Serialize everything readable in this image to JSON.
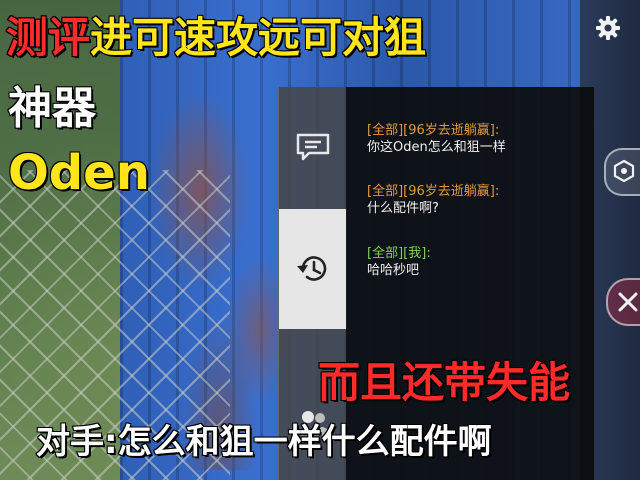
{
  "captions": {
    "title_red": "测评",
    "title_yellow": "进可速攻远可对狙",
    "subtitle_line1": "神器",
    "subtitle_line2": "Oden",
    "highlight": "而且还带失能",
    "bottom": "对手:怎么和狙一样什么配件啊"
  },
  "chat": {
    "messages": [
      {
        "channel": "[全部]",
        "sender": "[96岁去逝躺赢]",
        "suffix": ":",
        "text": "你这Oden怎么和狙一样",
        "head_color": "#e39a3c"
      },
      {
        "channel": "[全部]",
        "sender": "[96岁去逝躺赢]",
        "suffix": ":",
        "text": "什么配件啊?",
        "head_color": "#e39a3c"
      },
      {
        "channel": "[全部]",
        "sender": "[我]",
        "suffix": ":",
        "text": "哈哈秒吧",
        "head_color": "#7cd15a"
      }
    ],
    "tabs": [
      "chat-tab",
      "history-tab",
      "friends-tab"
    ]
  },
  "colors": {
    "caption_red": "#ff2a2a",
    "caption_yellow": "#ffe51a",
    "caption_white": "#ffffff"
  },
  "icons": {
    "settings": "gear-icon",
    "marker": "hex-marker-icon",
    "close": "close-icon"
  }
}
